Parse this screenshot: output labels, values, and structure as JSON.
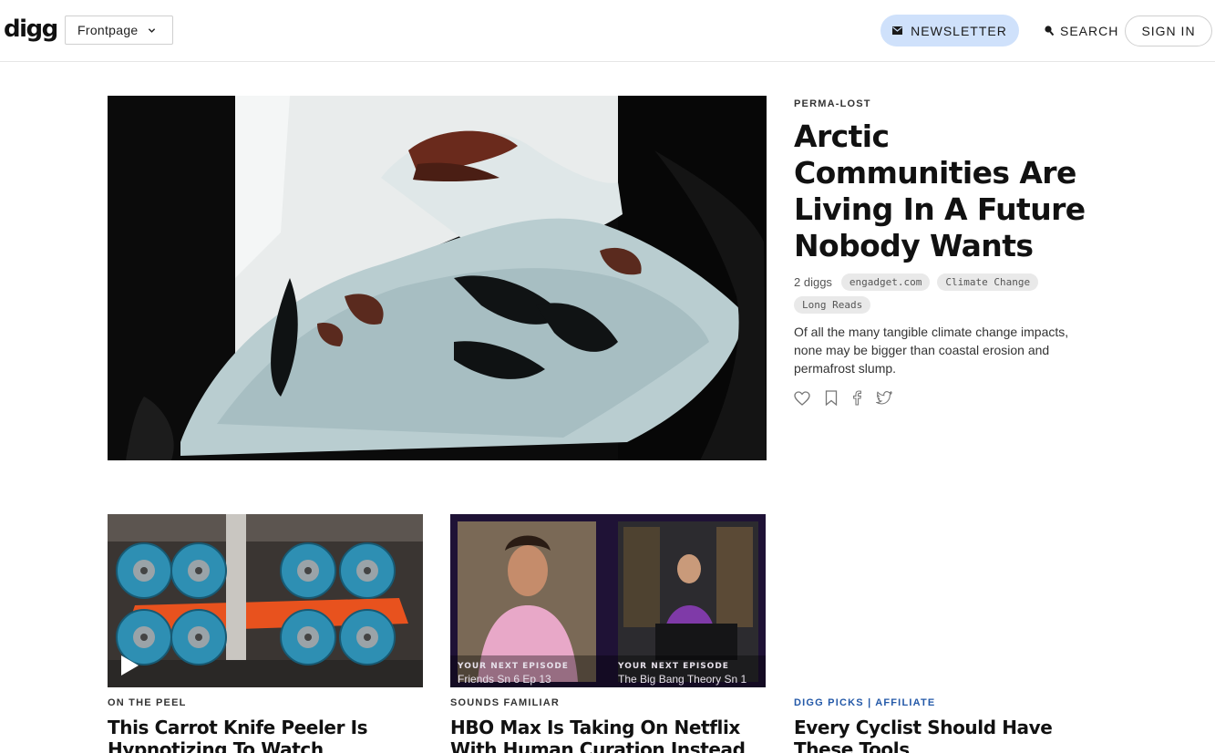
{
  "header": {
    "logo": "digg",
    "section_select": "Frontpage",
    "newsletter_label": "NEWSLETTER",
    "search_label": "SEARCH",
    "signin_label": "SIGN IN"
  },
  "hero": {
    "kicker": "PERMA-LOST",
    "title": "Arctic Communities Are Living In A Future Nobody Wants",
    "diggs": "2 diggs",
    "tags": [
      "engadget.com",
      "Climate Change",
      "Long Reads"
    ],
    "description": "Of all the many tangible climate change impacts, none may be bigger than coastal erosion and permafrost slump."
  },
  "cards": [
    {
      "kicker": "ON THE PEEL",
      "title": "This Carrot Knife Peeler Is Hypnotizing To Watch"
    },
    {
      "kicker": "SOUNDS FAMILIAR",
      "title": "HBO Max Is Taking On Netflix With Human Curation Instead Of",
      "overlay_left_label": "YOUR NEXT EPISODE",
      "overlay_left_show": "Friends Sn 6 Ep 13",
      "overlay_right_label": "YOUR NEXT EPISODE",
      "overlay_right_show": "The Big Bang Theory Sn 1"
    },
    {
      "kicker_main": "DIGG PICKS",
      "kicker_sep": "|",
      "kicker_sub": "AFFILIATE",
      "title": "Every Cyclist Should Have These Tools"
    }
  ],
  "colors": {
    "accent_blue": "#2459a8",
    "newsletter_bg": "#cfe1fb"
  },
  "icons": [
    "chevron-down-icon",
    "mail-icon",
    "search-icon",
    "heart-icon",
    "bookmark-icon",
    "facebook-icon",
    "twitter-icon",
    "play-icon"
  ]
}
